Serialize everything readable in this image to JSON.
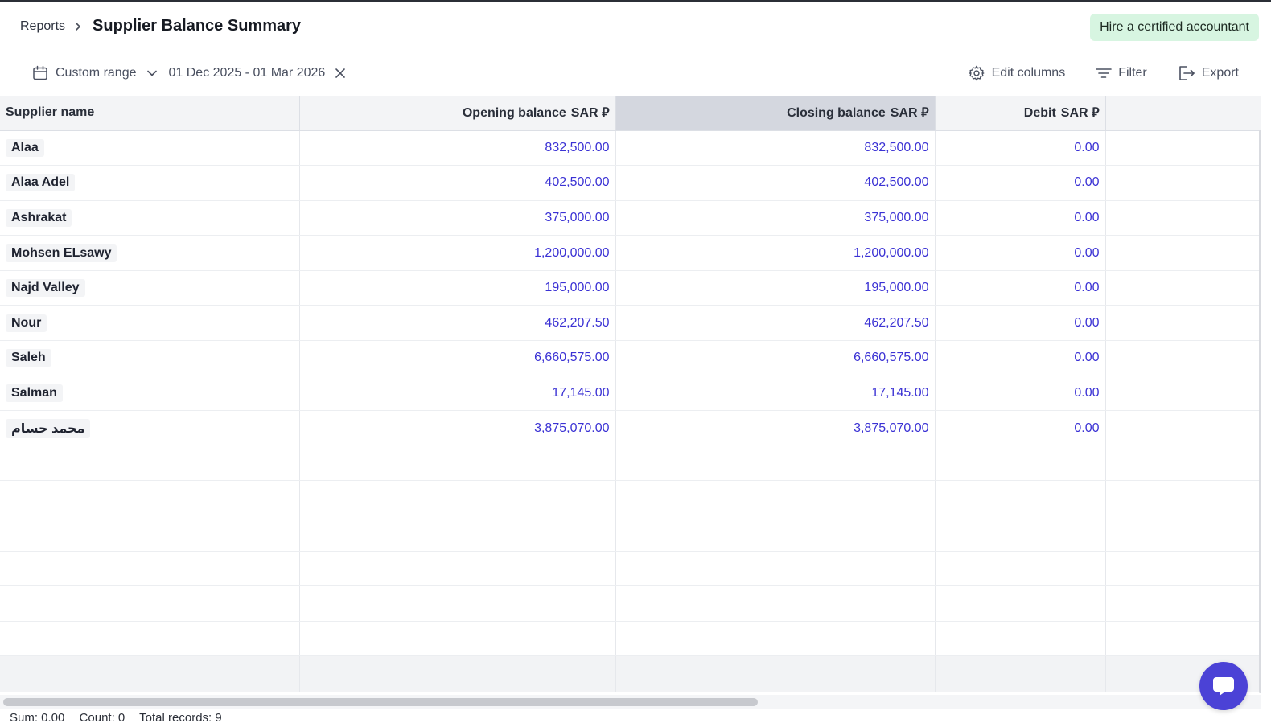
{
  "header": {
    "breadcrumb_root": "Reports",
    "title": "Supplier Balance Summary",
    "hire_button": "Hire a certified accountant"
  },
  "toolbar": {
    "range_type": "Custom range",
    "date_range": "01 Dec 2025 - 01 Mar 2026",
    "edit_columns": "Edit columns",
    "filter": "Filter",
    "export": "Export"
  },
  "table": {
    "columns": [
      {
        "label": "Supplier name",
        "currency": ""
      },
      {
        "label": "Opening balance",
        "currency": "SAR ⃁"
      },
      {
        "label": "Closing balance",
        "currency": "SAR ⃁"
      },
      {
        "label": "Debit",
        "currency": "SAR ⃁"
      }
    ],
    "currency_symbol": "⃁",
    "rows": [
      {
        "name": "Alaa",
        "opening": "832,500.00",
        "closing": "832,500.00",
        "debit": "0.00"
      },
      {
        "name": "Alaa Adel",
        "opening": "402,500.00",
        "closing": "402,500.00",
        "debit": "0.00"
      },
      {
        "name": "Ashrakat",
        "opening": "375,000.00",
        "closing": "375,000.00",
        "debit": "0.00"
      },
      {
        "name": "Mohsen ELsawy",
        "opening": "1,200,000.00",
        "closing": "1,200,000.00",
        "debit": "0.00"
      },
      {
        "name": "Najd Valley",
        "opening": "195,000.00",
        "closing": "195,000.00",
        "debit": "0.00"
      },
      {
        "name": "Nour",
        "opening": "462,207.50",
        "closing": "462,207.50",
        "debit": "0.00"
      },
      {
        "name": "Saleh",
        "opening": "6,660,575.00",
        "closing": "6,660,575.00",
        "debit": "0.00"
      },
      {
        "name": "Salman",
        "opening": "17,145.00",
        "closing": "17,145.00",
        "debit": "0.00"
      },
      {
        "name": "محمد حسام",
        "opening": "3,875,070.00",
        "closing": "3,875,070.00",
        "debit": "0.00"
      }
    ]
  },
  "status": {
    "sum": "Sum: 0.00",
    "count": "Count: 0",
    "total_records": "Total records: 9"
  },
  "colors": {
    "accent": "#4b42d6",
    "number_text": "#3b32d4",
    "hire_bg": "#d7f5e1",
    "header_bg": "#f3f4f6",
    "active_header_bg": "#d4d7df"
  },
  "icons": {
    "calendar": "calendar-icon",
    "chevron": "chevron-down-icon",
    "clear": "close-icon",
    "edit_columns": "gear-icon",
    "filter": "filter-icon",
    "export": "export-icon",
    "chat": "chat-icon"
  }
}
